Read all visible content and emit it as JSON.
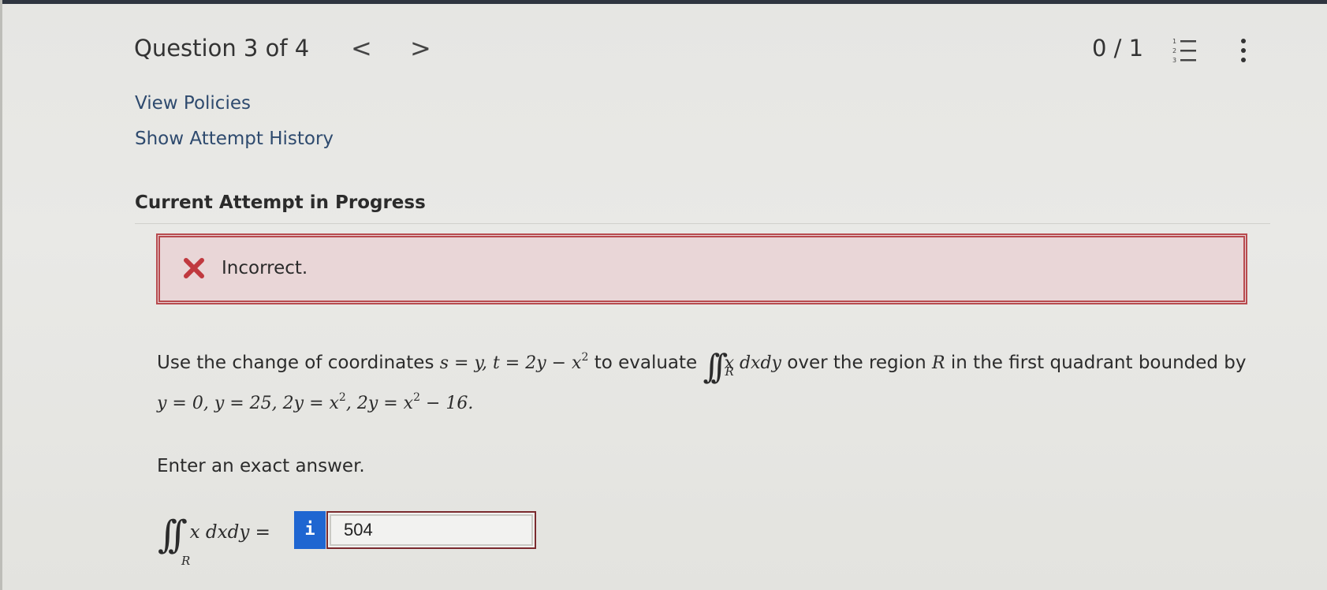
{
  "header": {
    "question_label": "Question 3 of 4",
    "prev_glyph": "<",
    "next_glyph": ">",
    "score": "0 / 1"
  },
  "links": {
    "view_policies": "View Policies",
    "attempt_history": "Show Attempt History"
  },
  "attempt": {
    "title": "Current Attempt in Progress"
  },
  "feedback": {
    "status": "Incorrect.",
    "color": "#b84b4f"
  },
  "problem": {
    "intro": "Use the change of coordinates ",
    "coords": "s = y, t = 2y − x",
    "sq": "2",
    "to_eval": " to evaluate ",
    "integral_sub": "R",
    "integrand": "x dxdy",
    "over": " over the region ",
    "region": "R",
    "rest": " in the first quadrant bounded by",
    "bounds_a": "y = 0, y = 25, 2y = x",
    "bounds_sq1": "2",
    "bounds_b": ", 2y = x",
    "bounds_sq2": "2",
    "bounds_c": " − 16."
  },
  "instruction": "Enter an exact answer.",
  "answer": {
    "integral_sub": "R",
    "lhs": "x dxdy =",
    "info_glyph": "i",
    "value": "504"
  },
  "icons": {
    "feedback": "x-mark-icon",
    "list": "numbered-list-icon",
    "more": "more-vertical-icon"
  }
}
